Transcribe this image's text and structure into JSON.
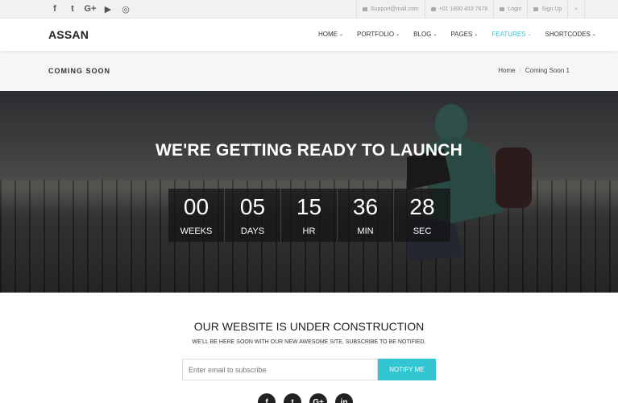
{
  "topbar": {
    "social": [
      {
        "icon": "facebook-icon",
        "glyph": "f"
      },
      {
        "icon": "twitter-icon",
        "glyph": "t"
      },
      {
        "icon": "google-plus-icon",
        "glyph": "G+"
      },
      {
        "icon": "youtube-icon",
        "glyph": "▶"
      },
      {
        "icon": "instagram-icon",
        "glyph": "◎"
      }
    ],
    "email": "Support@mail.com",
    "phone": "+01 1800 453 7678",
    "login": "Login",
    "signup": "Sign Up",
    "search_glyph": "⌕"
  },
  "navbar": {
    "logo": "ASSAN",
    "items": [
      "HOME",
      "PORTFOLIO",
      "BLOG",
      "PAGES",
      "FEATURES",
      "SHORTCODES"
    ],
    "caret": "⌄",
    "active_color": "#32c5d2"
  },
  "titlebar": {
    "title": "COMING SOON",
    "breadcrumb_home": "Home",
    "breadcrumb_sep": "/",
    "breadcrumb_current": "Coming Soon 1"
  },
  "hero": {
    "title": "WE'RE GETTING READY TO LAUNCH",
    "countdown": [
      {
        "value": "00",
        "label": "WEEKS"
      },
      {
        "value": "05",
        "label": "DAYS"
      },
      {
        "value": "15",
        "label": "HR"
      },
      {
        "value": "36",
        "label": "MIN"
      },
      {
        "value": "28",
        "label": "SEC"
      }
    ]
  },
  "construction": {
    "title": "OUR WEBSITE IS UNDER CONSTRUCTION",
    "subtitle": "WE'LL BE HERE SOON WITH OUR NEW AWESOME SITE, SUBSCRIBE TO BE NOTIFIED.",
    "placeholder": "Enter email to subscribe",
    "button": "NOTIFY ME",
    "social": [
      {
        "icon": "facebook-icon",
        "glyph": "f"
      },
      {
        "icon": "twitter-icon",
        "glyph": "t"
      },
      {
        "icon": "google-plus-icon",
        "glyph": "G+"
      },
      {
        "icon": "linkedin-icon",
        "glyph": "in"
      }
    ]
  }
}
